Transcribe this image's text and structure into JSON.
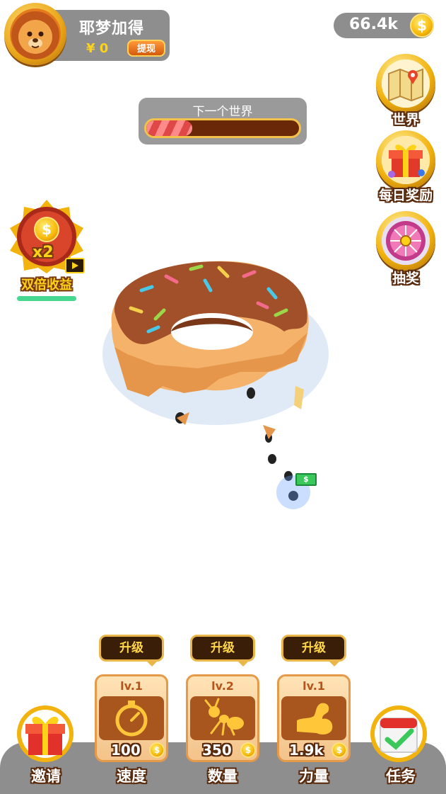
{
  "profile": {
    "username": "耶梦加得",
    "cash": "¥ 0",
    "withdraw_label": "提现"
  },
  "coins": {
    "amount": "66.4k",
    "coin_symbol": "$"
  },
  "progress": {
    "title": "下一个世界",
    "value": 0.3
  },
  "side_buttons": [
    {
      "label": "世界",
      "icon": "map-icon"
    },
    {
      "label": "每日奖励",
      "icon": "gift-box-icon"
    },
    {
      "label": "抽奖",
      "icon": "prize-wheel-icon"
    }
  ],
  "double_income": {
    "label": "双倍收益",
    "multiplier": "x2",
    "coin_symbol": "$"
  },
  "upgrades": [
    {
      "button_label": "升级",
      "level": "lv.1",
      "cost": "100",
      "label": "速度",
      "icon": "stopwatch-icon"
    },
    {
      "button_label": "升级",
      "level": "lv.2",
      "cost": "350",
      "label": "数量",
      "icon": "ant-icon"
    },
    {
      "button_label": "升级",
      "level": "lv.1",
      "cost": "1.9k",
      "label": "力量",
      "icon": "flexed-arm-icon"
    }
  ],
  "bottom": {
    "invite_label": "邀请",
    "tasks_label": "任务"
  },
  "game": {
    "money_symbol": "$"
  },
  "colors": {
    "accent_gold": "#f2b30f",
    "panel_gray": "#8e8e8e",
    "card_brown": "#a8561e",
    "progress_red": "#e04848",
    "bar_green": "#46d890"
  }
}
